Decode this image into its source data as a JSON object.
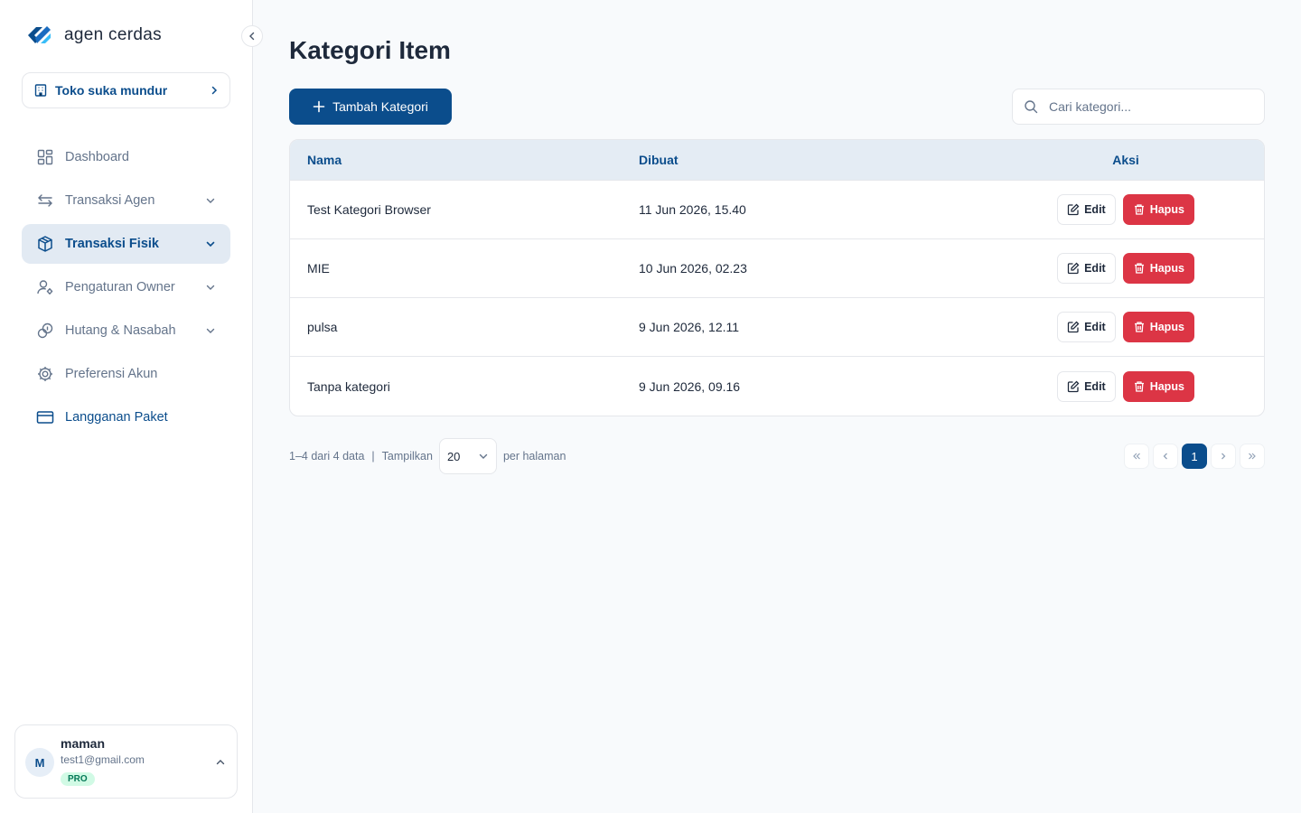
{
  "brand": {
    "name": "agen cerdas"
  },
  "store": {
    "label": "Toko suka mundur"
  },
  "nav": [
    {
      "label": "Dashboard",
      "icon": "grid-icon",
      "has_chevron": false,
      "state": "normal"
    },
    {
      "label": "Transaksi Agen",
      "icon": "arrows-exchange-icon",
      "has_chevron": true,
      "state": "normal"
    },
    {
      "label": "Transaksi Fisik",
      "icon": "box-icon",
      "has_chevron": true,
      "state": "active"
    },
    {
      "label": "Pengaturan Owner",
      "icon": "user-settings-icon",
      "has_chevron": true,
      "state": "normal"
    },
    {
      "label": "Hutang & Nasabah",
      "icon": "coins-icon",
      "has_chevron": true,
      "state": "normal"
    },
    {
      "label": "Preferensi Akun",
      "icon": "gear-icon",
      "has_chevron": false,
      "state": "normal"
    },
    {
      "label": "Langganan Paket",
      "icon": "credit-card-icon",
      "has_chevron": false,
      "state": "link"
    }
  ],
  "user": {
    "initial": "M",
    "name": "maman",
    "email": "test1@gmail.com",
    "badge": "PRO"
  },
  "page": {
    "title": "Kategori Item",
    "add_label": "Tambah Kategori",
    "search_placeholder": "Cari kategori..."
  },
  "table": {
    "headers": {
      "nama": "Nama",
      "dibuat": "Dibuat",
      "aksi": "Aksi"
    },
    "edit_label": "Edit",
    "delete_label": "Hapus",
    "rows": [
      {
        "nama": "Test Kategori Browser",
        "dibuat": "11 Jun 2026, 15.40"
      },
      {
        "nama": "MIE",
        "dibuat": "10 Jun 2026, 02.23"
      },
      {
        "nama": "pulsa",
        "dibuat": "9 Jun 2026, 12.11"
      },
      {
        "nama": "Tanpa kategori",
        "dibuat": "9 Jun 2026, 09.16"
      }
    ]
  },
  "pagination": {
    "range": "1–4 dari 4 data",
    "show_label": "Tampilkan",
    "per_page": "20",
    "per_page_suffix": "per halaman",
    "current_page": "1"
  },
  "colors": {
    "primary": "#0b4d8c",
    "danger": "#dc3545",
    "header_bg": "#e4ecf4",
    "active_nav": "#e2eaf3",
    "pro_badge": "#d1fae5"
  }
}
